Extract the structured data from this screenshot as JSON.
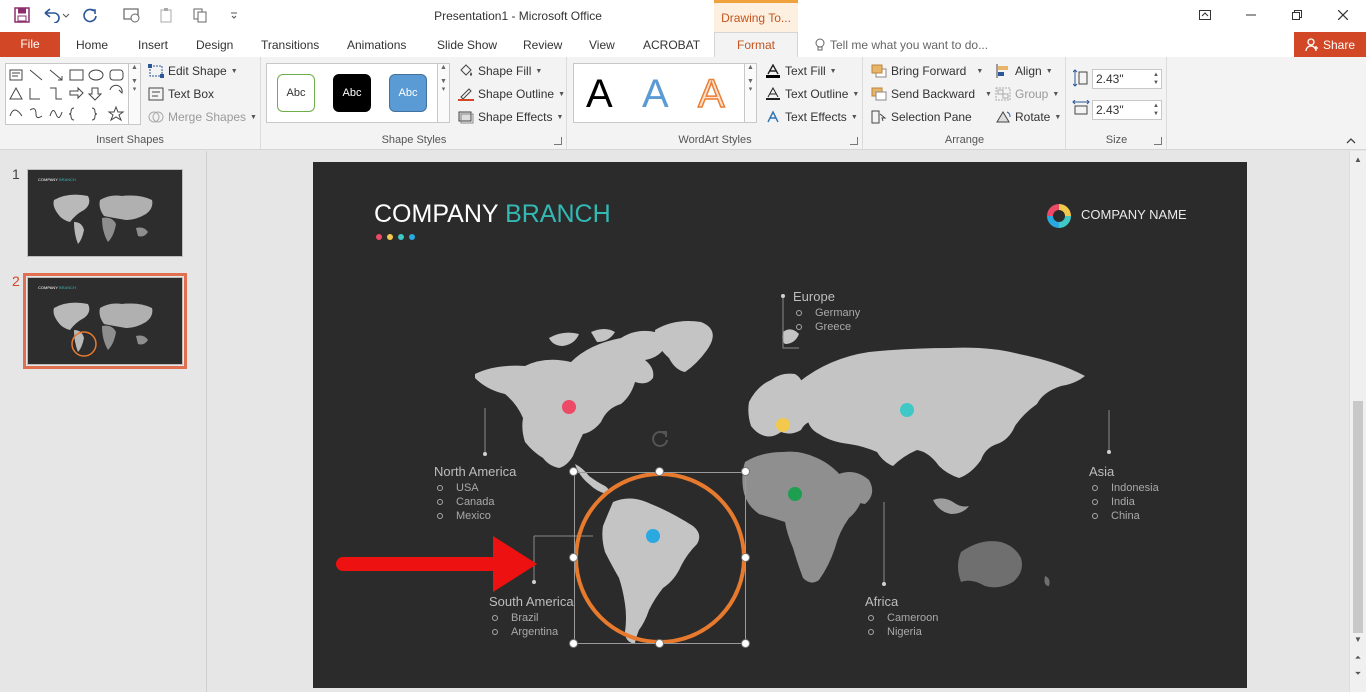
{
  "window": {
    "title": "Presentation1 - Microsoft Office",
    "contextual_tab_header": "Drawing To..."
  },
  "ribbon_tabs": {
    "file": "File",
    "tabs": [
      "Home",
      "Insert",
      "Design",
      "Transitions",
      "Animations",
      "Slide Show",
      "Review",
      "View",
      "ACROBAT"
    ],
    "format": "Format",
    "tell_me": "Tell me what you want to do...",
    "share": "Share"
  },
  "ribbon": {
    "insert_shapes": {
      "label": "Insert Shapes",
      "edit_shape": "Edit Shape",
      "text_box": "Text Box",
      "merge_shapes": "Merge Shapes"
    },
    "shape_styles": {
      "label": "Shape Styles",
      "swatches": [
        "Abc",
        "Abc",
        "Abc"
      ],
      "shape_fill": "Shape Fill",
      "shape_outline": "Shape Outline",
      "shape_effects": "Shape Effects"
    },
    "wordart_styles": {
      "label": "WordArt Styles",
      "samples": [
        "A",
        "A",
        "A"
      ],
      "text_fill": "Text Fill",
      "text_outline": "Text Outline",
      "text_effects": "Text Effects"
    },
    "arrange": {
      "label": "Arrange",
      "bring_forward": "Bring Forward",
      "send_backward": "Send Backward",
      "selection_pane": "Selection Pane",
      "align": "Align",
      "group": "Group",
      "rotate": "Rotate"
    },
    "size": {
      "label": "Size",
      "height": "2.43\"",
      "width": "2.43\""
    }
  },
  "slides_panel": {
    "slides": [
      {
        "number": "1",
        "title_a": "COMPANY",
        "title_b": "BRANCH"
      },
      {
        "number": "2",
        "title_a": "COMPANY",
        "title_b": "BRANCH"
      }
    ],
    "selected": 2
  },
  "slide": {
    "title_part1": "COMPANY",
    "title_part2": "BRANCH",
    "company_name": "COMPANY NAME",
    "regions": {
      "europe": {
        "name": "Europe",
        "items": [
          "Germany",
          "Greece"
        ]
      },
      "north_america": {
        "name": "North America",
        "items": [
          "USA",
          "Canada",
          "Mexico"
        ]
      },
      "asia": {
        "name": "Asia",
        "items": [
          "Indonesia",
          "India",
          "China"
        ]
      },
      "south_america": {
        "name": "South America",
        "items": [
          "Brazil",
          "Argentina"
        ]
      },
      "africa": {
        "name": "Africa",
        "items": [
          "Cameroon",
          "Nigeria"
        ]
      }
    }
  },
  "colors": {
    "accent_orange": "#d24726",
    "circle_orange": "#e87a2e",
    "teal": "#33b9b4",
    "arrow_red": "#ee1111",
    "dot_red": "#ec4a67",
    "dot_yellow": "#f2c94c",
    "dot_cyan": "#3fc8c6",
    "dot_blue": "#29a9e0",
    "dot_green": "#1e9e4f"
  }
}
